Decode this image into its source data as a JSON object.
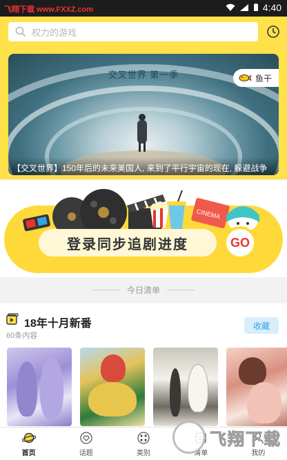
{
  "statusbar": {
    "source_label": "飞翔下载 www.FXXZ.com",
    "time": "4:40"
  },
  "search": {
    "placeholder": "权力的游戏"
  },
  "banner": {
    "title": "交叉世界 第一季",
    "tag": "鱼干",
    "caption": "【交叉世界】150年后的未来美国人, 来到了平行宇宙的现在, 躲避战争"
  },
  "promo": {
    "text": "登录同步追剧进度",
    "go": "GO",
    "cinema": "CINEMA"
  },
  "today": {
    "label": "今日清单"
  },
  "section": {
    "title": "18年十月新番",
    "count": "60条内容",
    "fav_label": "收藏"
  },
  "nav": [
    {
      "label": "首页",
      "icon": "planet-icon"
    },
    {
      "label": "话题",
      "icon": "heart-chat-icon"
    },
    {
      "label": "类别",
      "icon": "grid-dots-icon"
    },
    {
      "label": "清单",
      "icon": "list-icon"
    },
    {
      "label": "我的",
      "icon": "user-icon"
    }
  ],
  "watermark": {
    "text": "飞翔下载"
  },
  "colors": {
    "accent": "#ffe14a",
    "fav_blue": "#35a3e6",
    "go_red": "#e8352e"
  }
}
